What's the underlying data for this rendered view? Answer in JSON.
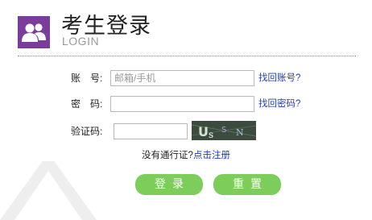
{
  "header": {
    "title": "考生登录",
    "subtitle": "LOGIN",
    "logo_icon": "users-icon",
    "logo_color": "#7a3d9c"
  },
  "form": {
    "account": {
      "label": "账　号:",
      "placeholder": "邮箱/手机",
      "value": "",
      "link": "找回账号?"
    },
    "password": {
      "label": "密　码:",
      "value": "",
      "link": "找回密码?"
    },
    "captcha": {
      "label": "验证码:",
      "value": "",
      "image_text": "UsSN"
    }
  },
  "register": {
    "prefix": "没有通行证?",
    "link": "点击注册"
  },
  "buttons": {
    "login": "登录",
    "reset": "重置",
    "color": "#7dcd5b"
  }
}
